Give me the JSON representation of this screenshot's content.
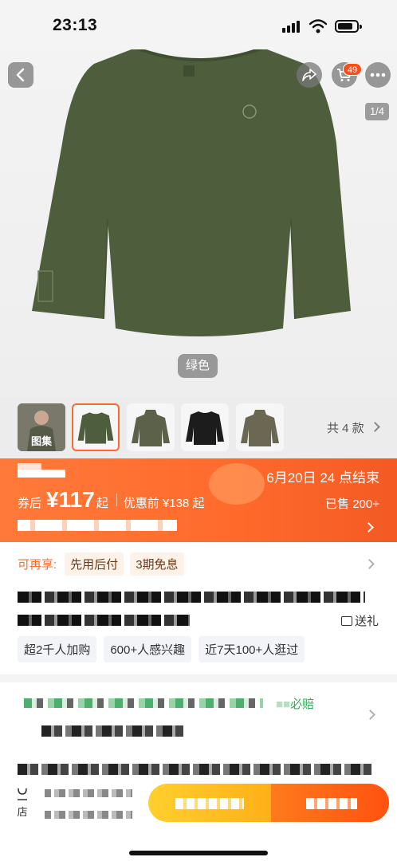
{
  "status_bar": {
    "time": "23:13"
  },
  "header": {
    "cart_badge": "49",
    "image_counter": "1/4",
    "color_name": "绿色"
  },
  "thumbnails": {
    "gallery_label": "图集",
    "variant_count": "共 4 款"
  },
  "price_banner": {
    "deadline": "6月20日 24 点结束",
    "coupon_label": "券后",
    "price": "¥117",
    "price_suffix": "起",
    "original_label": "优惠前 ¥138 起",
    "sold": "已售 200+"
  },
  "benefits": {
    "label": "可再享:",
    "tags": [
      "先用后付",
      "3期免息"
    ]
  },
  "gift_label": "送礼",
  "stats": [
    "超2千人加购",
    "600+人感兴趣",
    "近7天100+人逛过"
  ],
  "service_badge": "必赔",
  "bottom": {
    "store_label": "店"
  },
  "colors": {
    "accent": "#ff6a2c",
    "shirt": "#4e5e3d",
    "service_green": "#3aa45a"
  }
}
